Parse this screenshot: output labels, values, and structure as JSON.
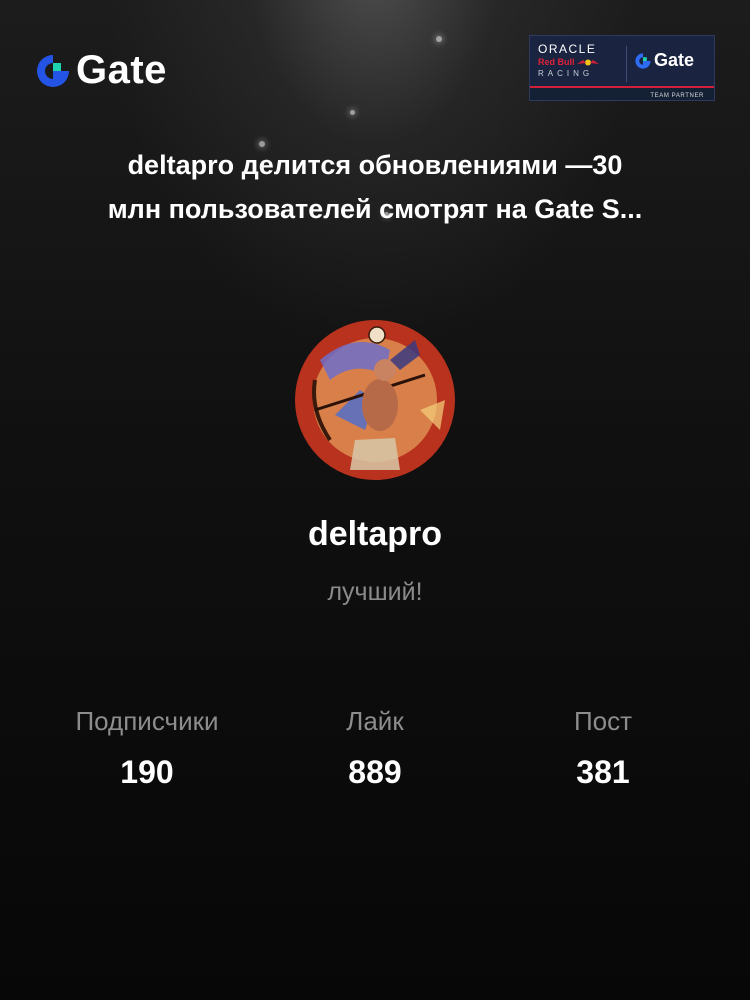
{
  "brand": {
    "logo_text": "Gate",
    "logo_color": "#2354e6",
    "logo_accent": "#20d3b0"
  },
  "partner_badge": {
    "oracle": "ORACLE",
    "red_bull": "Red Bull",
    "racing": "RACING",
    "gate": "Gate",
    "team_partner": "TEAM PARTNER",
    "accent_color": "#d41f3a"
  },
  "headline": {
    "line1": "deltapro делится обновлениями —30",
    "line2": "млн пользователей смотрят на Gate S..."
  },
  "profile": {
    "username": "deltapro",
    "bio": "лучший!"
  },
  "stats": [
    {
      "label": "Подписчики",
      "value": "190"
    },
    {
      "label": "Лайк",
      "value": "889"
    },
    {
      "label": "Пост",
      "value": "381"
    }
  ]
}
